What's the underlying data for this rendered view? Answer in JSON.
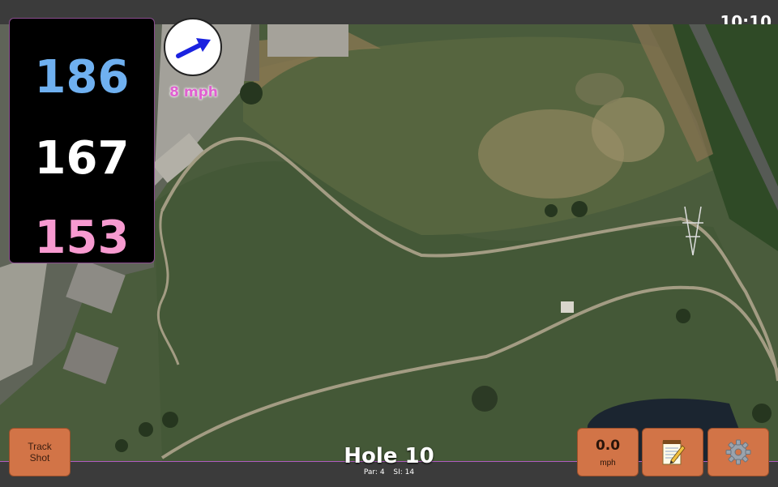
{
  "status": {
    "time": "10:10"
  },
  "distances": {
    "back": "186",
    "center": "167",
    "front": "153",
    "colors": {
      "back": "#6fb0f0",
      "center": "#ffffff",
      "front": "#f79ad0"
    }
  },
  "wind": {
    "speed_label": "8 mph",
    "arrow_icon": "wind-direction-arrow-icon",
    "arrow_color": "#1a22e0"
  },
  "hole": {
    "title": "Hole 10",
    "par": "Par: 4",
    "si": "SI: 14"
  },
  "buttons": {
    "track_line1": "Track",
    "track_line2": "Shot",
    "wind_value": "0.0",
    "wind_unit": "mph",
    "notes_icon": "notepad-icon",
    "settings_icon": "gear-icon"
  }
}
